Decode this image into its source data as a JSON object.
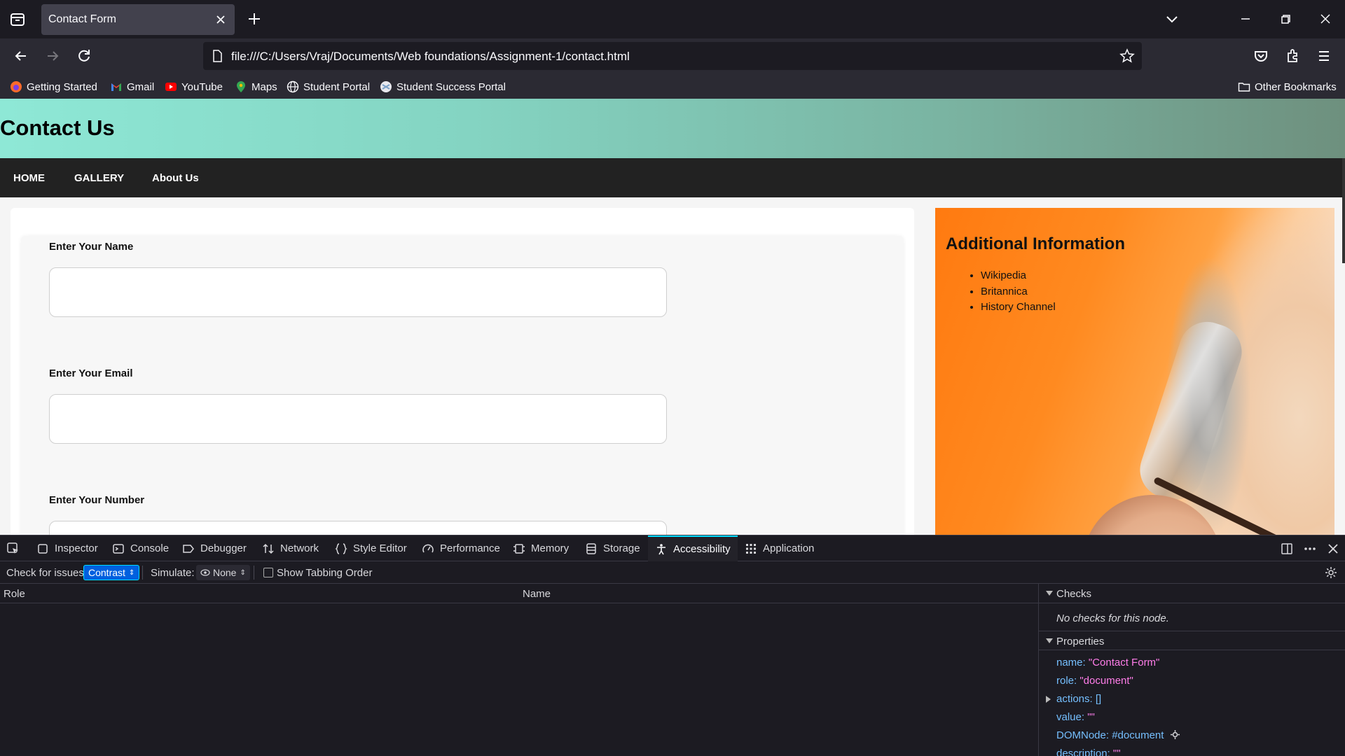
{
  "browser": {
    "tab_title": "Contact Form",
    "url": "file:///C:/Users/Vraj/Documents/Web foundations/Assignment-1/contact.html",
    "bookmarks": [
      {
        "label": "Getting Started",
        "icon": "firefox-icon"
      },
      {
        "label": "Gmail",
        "icon": "gmail-icon"
      },
      {
        "label": "YouTube",
        "icon": "youtube-icon"
      },
      {
        "label": "Maps",
        "icon": "maps-icon"
      },
      {
        "label": "Student Portal",
        "icon": "globe-icon"
      },
      {
        "label": "Student Success Portal",
        "icon": "portal-icon"
      }
    ],
    "other_bookmarks": "Other Bookmarks"
  },
  "page": {
    "header_title": "Contact Us",
    "nav": [
      "HOME",
      "GALLERY",
      "About Us"
    ],
    "form": {
      "name_label": "Enter Your Name",
      "email_label": "Enter Your Email",
      "number_label": "Enter Your Number"
    },
    "aside": {
      "title": "Additional Information",
      "links": [
        "Wikipedia",
        "Britannica",
        "History Channel"
      ]
    }
  },
  "devtools": {
    "tabs": [
      "Inspector",
      "Console",
      "Debugger",
      "Network",
      "Style Editor",
      "Performance",
      "Memory",
      "Storage",
      "Accessibility",
      "Application"
    ],
    "active_tab": "Accessibility",
    "check_label": "Check for issues:",
    "check_value": "Contrast",
    "simulate_label": "Simulate:",
    "simulate_value": "None",
    "tabbing_label": "Show Tabbing Order",
    "tree_columns": {
      "role": "Role",
      "name": "Name"
    },
    "checks_title": "Checks",
    "checks_message": "No checks for this node.",
    "properties_title": "Properties",
    "properties": [
      {
        "key": "name:",
        "value": "\"Contact Form\""
      },
      {
        "key": "role:",
        "value": "\"document\""
      },
      {
        "key": "actions:",
        "value": "[]"
      },
      {
        "key": "value:",
        "value": "\"\""
      },
      {
        "key": "DOMNode:",
        "value": "#document"
      },
      {
        "key": "description:",
        "value": "\"\""
      }
    ]
  },
  "colors": {
    "accent": "#00ddff",
    "header_gradient_start": "#8ee8d6",
    "nav_bg": "#222222"
  }
}
